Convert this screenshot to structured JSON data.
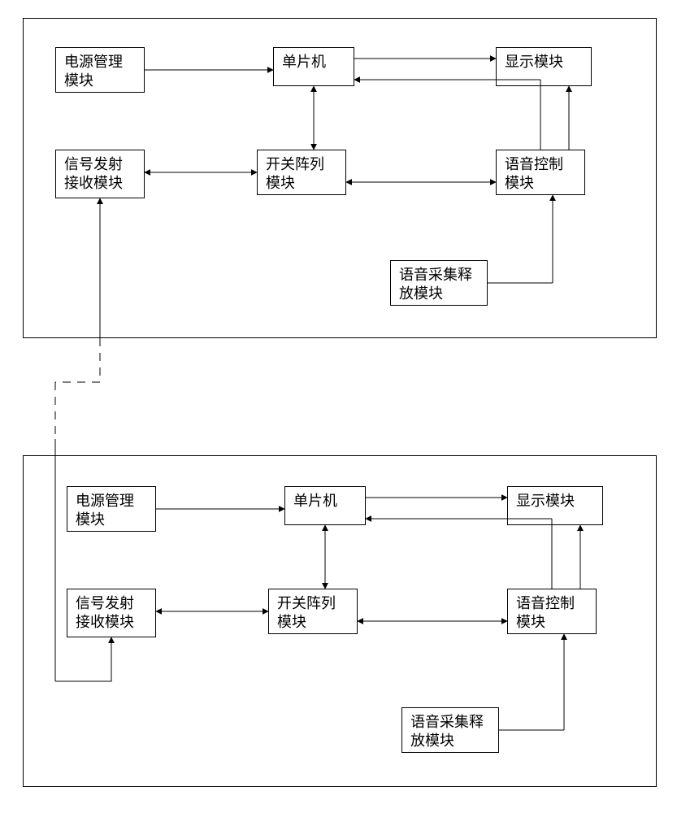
{
  "diagram": {
    "unitA": {
      "power": "电源管理模块",
      "mcu": "单片机",
      "display": "显示模块",
      "rf": "信号发射接收模块",
      "switch": "开关阵列模块",
      "voice": "语音控制模块",
      "audio": "语音采集释放模块"
    },
    "unitB": {
      "power": "电源管理模块",
      "mcu": "单片机",
      "display": "显示模块",
      "rf": "信号发射接收模块",
      "switch": "开关阵列模块",
      "voice": "语音控制模块",
      "audio": "语音采集释放模块"
    }
  }
}
